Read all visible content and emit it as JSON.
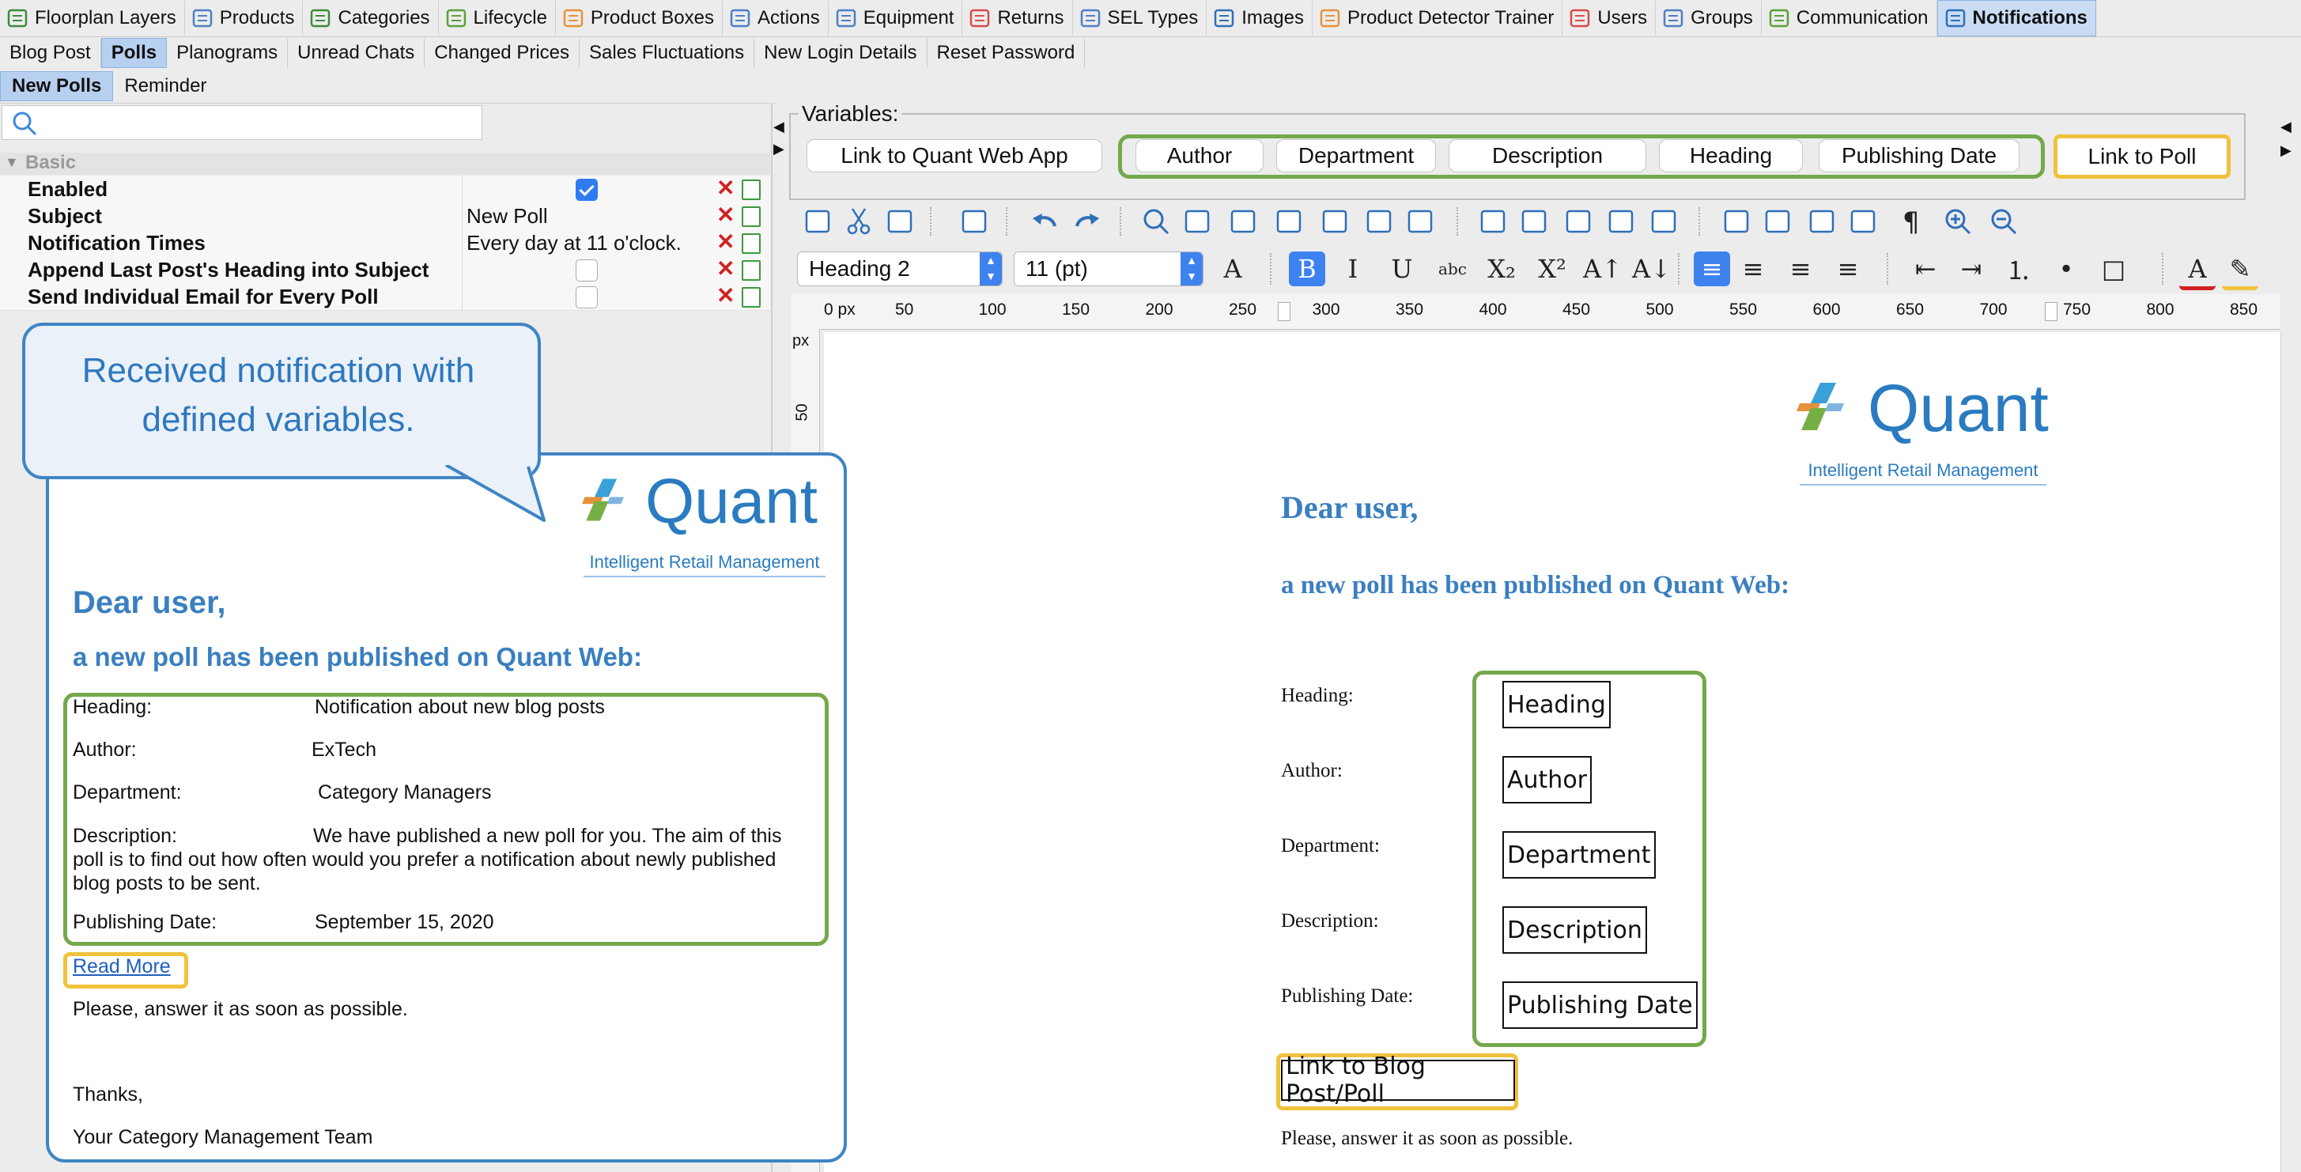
{
  "top_tabs": [
    {
      "label": "Floorplan Layers",
      "icon": "layers-icon"
    },
    {
      "label": "Products",
      "icon": "products-icon"
    },
    {
      "label": "Categories",
      "icon": "categories-icon"
    },
    {
      "label": "Lifecycle",
      "icon": "lifecycle-icon"
    },
    {
      "label": "Product Boxes",
      "icon": "product-boxes-icon"
    },
    {
      "label": "Actions",
      "icon": "actions-icon"
    },
    {
      "label": "Equipment",
      "icon": "equipment-icon"
    },
    {
      "label": "Returns",
      "icon": "returns-icon"
    },
    {
      "label": "SEL Types",
      "icon": "sel-tag-icon"
    },
    {
      "label": "Images",
      "icon": "images-icon"
    },
    {
      "label": "Product Detector Trainer",
      "icon": "trainer-icon"
    },
    {
      "label": "Users",
      "icon": "users-icon"
    },
    {
      "label": "Groups",
      "icon": "groups-icon"
    },
    {
      "label": "Communication",
      "icon": "envelope-icon"
    },
    {
      "label": "Notifications",
      "icon": "notifications-icon"
    }
  ],
  "active_top_tab": "Notifications",
  "sub_tabs": [
    "Blog Post",
    "Polls",
    "Planograms",
    "Unread Chats",
    "Changed Prices",
    "Sales Fluctuations",
    "New Login Details",
    "Reset Password"
  ],
  "active_sub_tab": "Polls",
  "third_tabs": [
    "New Polls",
    "Reminder"
  ],
  "active_third_tab": "New Polls",
  "properties": {
    "group": "Basic",
    "rows": [
      {
        "label": "Enabled",
        "type": "checkbox",
        "checked": true
      },
      {
        "label": "Subject",
        "type": "text",
        "value": "New Poll"
      },
      {
        "label": "Notification Times",
        "type": "text",
        "value": "Every day at 11 o'clock."
      },
      {
        "label": "Append Last Post's Heading into Subject",
        "type": "checkbox",
        "checked": false
      },
      {
        "label": "Send Individual Email for Every Poll",
        "type": "checkbox",
        "checked": false
      }
    ]
  },
  "callout": {
    "text": "Received notification with defined variables."
  },
  "preview": {
    "logo_name": "Quant",
    "logo_tagline": "Intelligent Retail Management",
    "greeting": "Dear user,",
    "intro": "a new poll has been published on Quant Web:",
    "fields": [
      {
        "label": "Heading:",
        "value": "Notification about new blog posts"
      },
      {
        "label": "Author:",
        "value": "ExTech"
      },
      {
        "label": "Department:",
        "value": "Category Managers"
      },
      {
        "label": "Description:",
        "value": "We have published a new poll for you. The aim of this poll is to find out how often would you prefer a notification about newly published blog posts to be sent."
      },
      {
        "label": "Publishing Date:",
        "value": "September 15, 2020"
      }
    ],
    "read_more": "Read More",
    "please": "Please, answer it as soon as possible.",
    "thanks": "Thanks,",
    "signature": "Your Category Management Team"
  },
  "variables": {
    "label": "Variables:",
    "link_web_app": "Link to Quant Web App",
    "group": [
      "Author",
      "Department",
      "Description",
      "Heading",
      "Publishing Date"
    ],
    "link_poll": "Link to Poll"
  },
  "format": {
    "style": "Heading 2",
    "size": "11 (pt)"
  },
  "ruler": {
    "unit": "0 px",
    "ticks": [
      "50",
      "100",
      "150",
      "200",
      "250",
      "300",
      "350",
      "400",
      "450",
      "500",
      "550",
      "600",
      "650",
      "700",
      "750",
      "800",
      "850"
    ],
    "vunit": "px",
    "vtick": "50"
  },
  "editor": {
    "logo_name": "Quant",
    "logo_tagline": "Intelligent Retail Management",
    "greeting": "Dear user,",
    "intro": "a new poll has been published on Quant Web:",
    "labels": [
      "Heading:",
      "Author:",
      "Department:",
      "Description:",
      "Publishing Date:"
    ],
    "vars": [
      "Heading",
      "Author",
      "Department",
      "Description",
      "Publishing Date"
    ],
    "link_var": "Link to Blog Post/Poll",
    "please": "Please, answer it as soon as possible."
  },
  "colors": {
    "accent_blue": "#3a7fc0",
    "green": "#74a84a",
    "yellow": "#f0c23c",
    "callout_border": "#3f85c4"
  }
}
